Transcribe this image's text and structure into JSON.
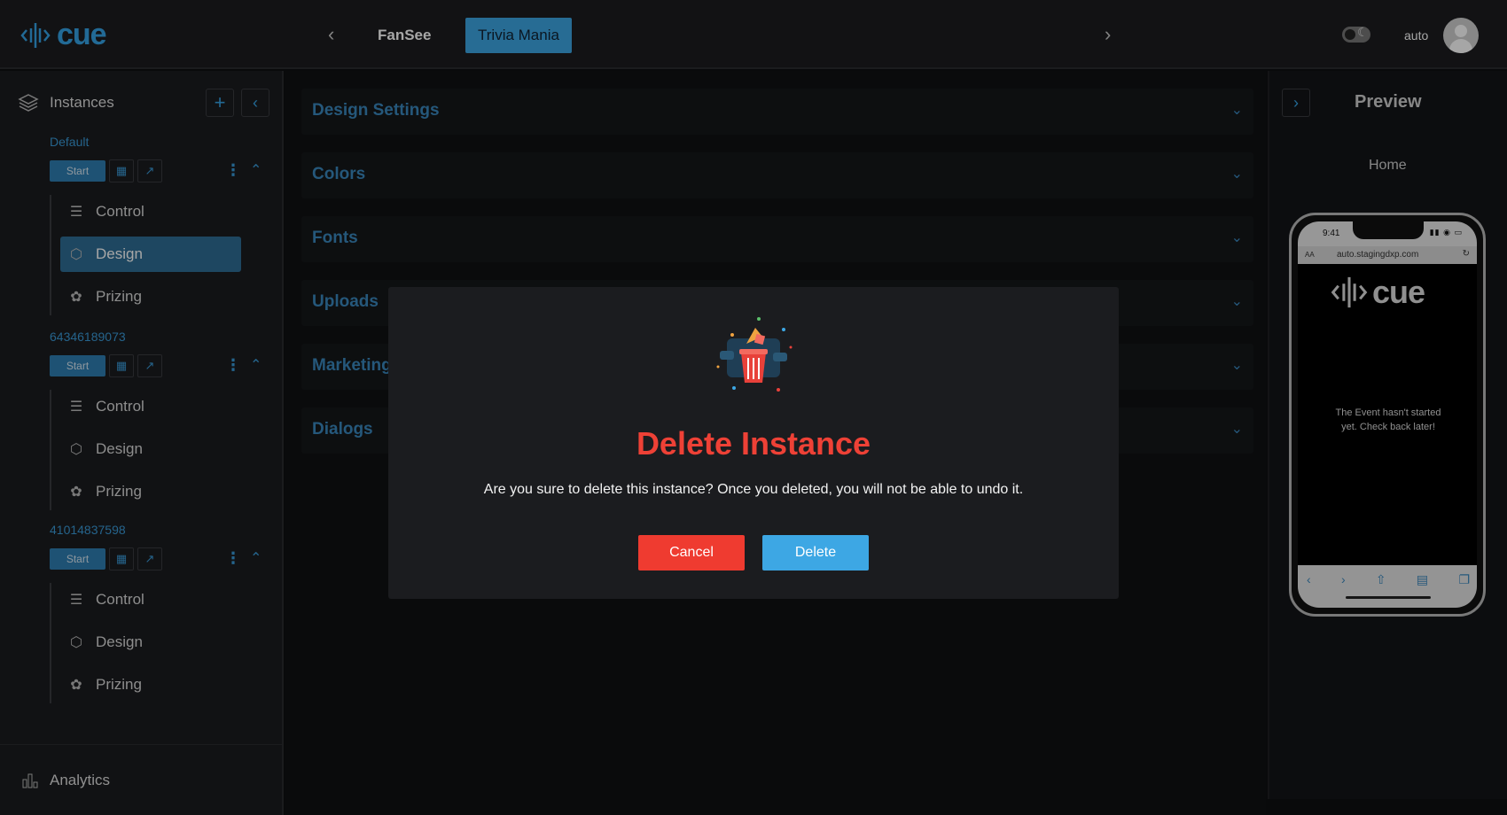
{
  "header": {
    "logo_text": "cue",
    "tabs": [
      {
        "label": "FanSee"
      },
      {
        "label": "Trivia Mania"
      }
    ],
    "username": "auto"
  },
  "sidebar": {
    "title": "Instances",
    "instances": [
      {
        "id": "Default",
        "start_label": "Start",
        "menu": [
          {
            "label": "Control"
          },
          {
            "label": "Design"
          },
          {
            "label": "Prizing"
          }
        ]
      },
      {
        "id": "64346189073",
        "start_label": "Start",
        "menu": [
          {
            "label": "Control"
          },
          {
            "label": "Design"
          },
          {
            "label": "Prizing"
          }
        ]
      },
      {
        "id": "41014837598",
        "start_label": "Start",
        "menu": [
          {
            "label": "Control"
          },
          {
            "label": "Design"
          },
          {
            "label": "Prizing"
          }
        ]
      }
    ],
    "footer_label": "Analytics"
  },
  "main": {
    "sections": [
      {
        "title": "Design Settings"
      },
      {
        "title": "Colors"
      },
      {
        "title": "Fonts"
      },
      {
        "title": "Uploads"
      },
      {
        "title": "Marketing"
      },
      {
        "title": "Dialogs"
      }
    ]
  },
  "preview": {
    "title": "Preview",
    "page": "Home",
    "phone": {
      "time": "9:41",
      "url_aa": "AA",
      "url": "auto.stagingdxp.com",
      "logo_text": "cue",
      "message": "The Event hasn't started yet. Check back later!"
    }
  },
  "modal": {
    "title": "Delete Instance",
    "text": "Are you sure to delete this instance? Once you deleted, you will not be able to undo it.",
    "cancel_label": "Cancel",
    "delete_label": "Delete"
  },
  "colors": {
    "accent": "#3da7e4",
    "danger": "#ef3b30",
    "active_menu": "#2f6e95"
  }
}
